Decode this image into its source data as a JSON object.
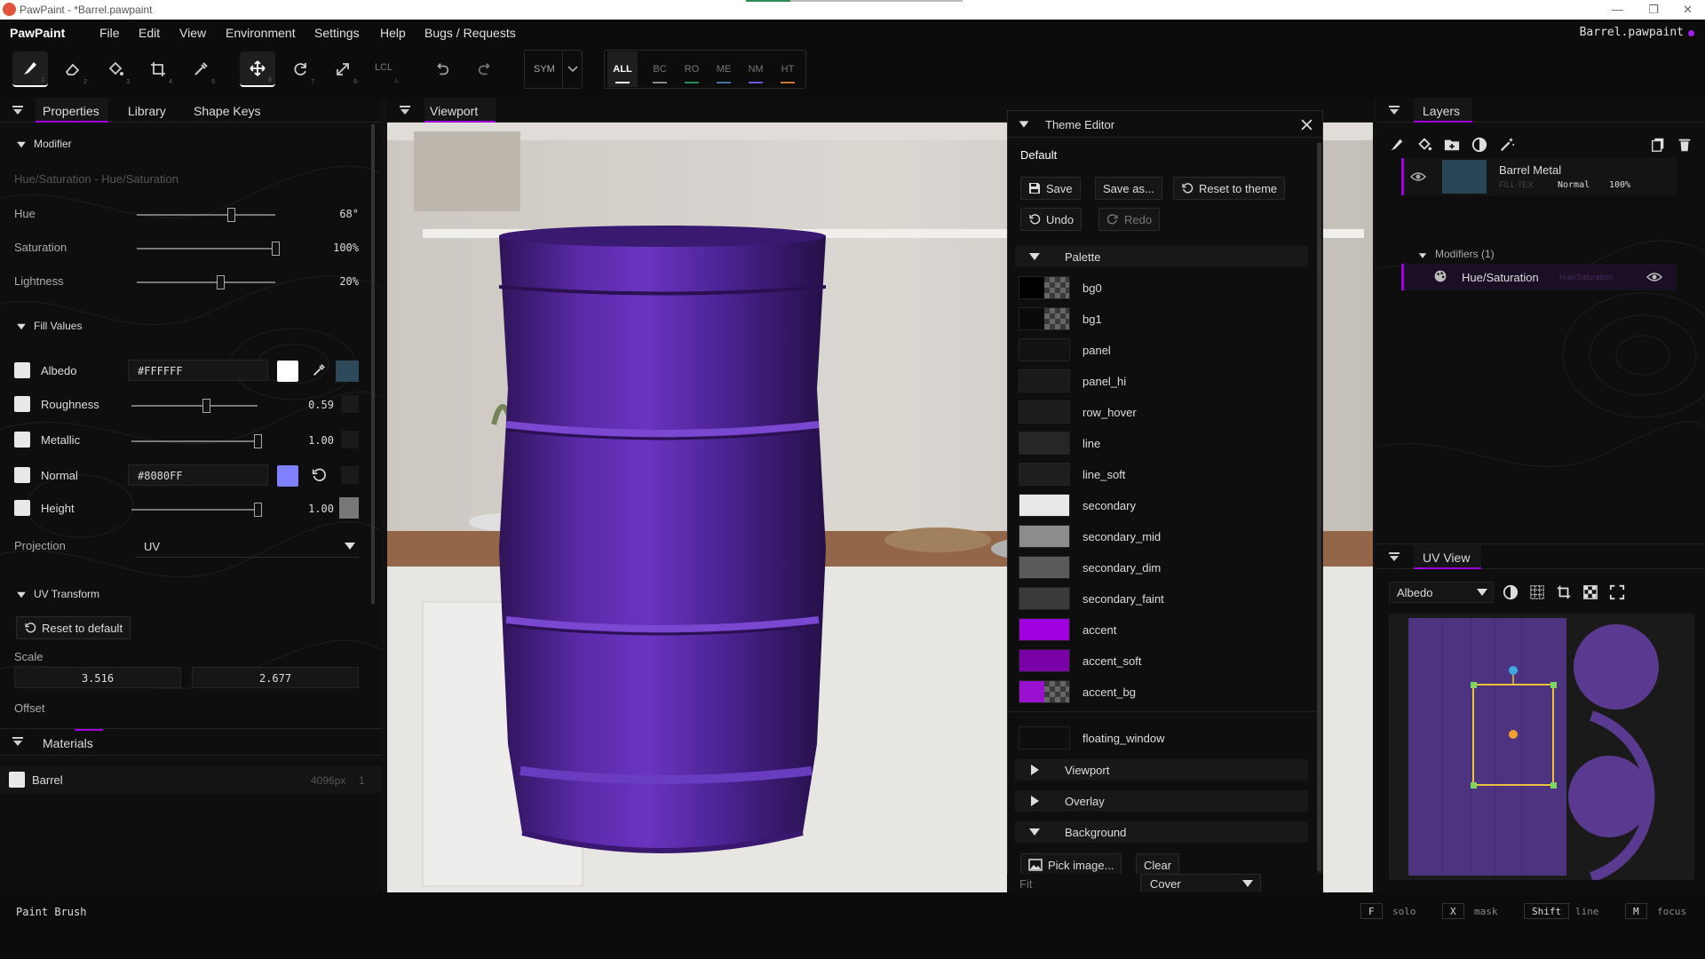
{
  "window": {
    "title": "PawPaint - *Barrel.pawpaint"
  },
  "menubar": {
    "brand": "PawPaint",
    "items": [
      "File",
      "Edit",
      "View",
      "Environment",
      "Settings",
      "Help",
      "Bugs / Requests"
    ],
    "file": "Barrel.pawpaint"
  },
  "toolbar": {
    "tool_numbers": [
      "1",
      "2",
      "3",
      "4",
      "5",
      "6",
      "7",
      "8"
    ],
    "lcl": "LCL",
    "lcl_key": "L",
    "sym": "SYM",
    "channels": [
      "ALL",
      "BC",
      "RO",
      "ME",
      "NM",
      "HT"
    ],
    "channel_colors": [
      "#ffffff",
      "#888888",
      "#2e8b57",
      "#4a6fa5",
      "#6a5acd",
      "#c87533"
    ]
  },
  "left": {
    "tabs": [
      "Properties",
      "Library",
      "Shape Keys"
    ],
    "modifier": {
      "header": "Modifier",
      "subtitle": "Hue/Saturation - Hue/Saturation",
      "rows": [
        {
          "label": "Hue",
          "value": "68°",
          "frac": 0.68
        },
        {
          "label": "Saturation",
          "value": "100%",
          "frac": 1.0
        },
        {
          "label": "Lightness",
          "value": "20%",
          "frac": 0.6
        }
      ]
    },
    "fill": {
      "header": "Fill Values",
      "albedo": {
        "label": "Albedo",
        "value": "#FFFFFF"
      },
      "roughness": {
        "label": "Roughness",
        "value": "0.59",
        "frac": 0.59
      },
      "metallic": {
        "label": "Metallic",
        "value": "1.00",
        "frac": 1.0
      },
      "normal": {
        "label": "Normal",
        "value": "#8080FF"
      },
      "height": {
        "label": "Height",
        "value": "1.00",
        "frac": 1.0
      },
      "projection": {
        "label": "Projection",
        "value": "UV"
      }
    },
    "uv": {
      "header": "UV Transform",
      "reset": "Reset to default",
      "scale_label": "Scale",
      "scale": [
        "3.516",
        "2.677"
      ],
      "offset_label": "Offset"
    },
    "materials": {
      "header": "Materials",
      "items": [
        {
          "name": "Barrel",
          "size": "4096px",
          "count": "1"
        }
      ]
    }
  },
  "viewport": {
    "title": "Viewport"
  },
  "theme": {
    "title": "Theme Editor",
    "name": "Default",
    "save": "Save",
    "save_as": "Save as...",
    "reset": "Reset to theme",
    "undo": "Undo",
    "redo": "Redo",
    "palette_header": "Palette",
    "palette": [
      {
        "name": "bg0",
        "color": "#000000",
        "checker": true
      },
      {
        "name": "bg1",
        "color": "#0a0a0a",
        "checker": true
      },
      {
        "name": "panel",
        "color": "#121212"
      },
      {
        "name": "panel_hi",
        "color": "#1a1a1a"
      },
      {
        "name": "row_hover",
        "color": "#1c1c1c"
      },
      {
        "name": "line",
        "color": "#262626"
      },
      {
        "name": "line_soft",
        "color": "#1e1e1e"
      },
      {
        "name": "secondary",
        "color": "#e8e8e8"
      },
      {
        "name": "secondary_mid",
        "color": "#8c8c8c"
      },
      {
        "name": "secondary_dim",
        "color": "#5a5a5a"
      },
      {
        "name": "secondary_faint",
        "color": "#3a3a3a"
      },
      {
        "name": "accent",
        "color": "#a000e0"
      },
      {
        "name": "accent_soft",
        "color": "#7a00a8"
      },
      {
        "name": "accent_bg",
        "color": "#9a10d0",
        "checker": true
      }
    ],
    "floating": {
      "name": "floating_window",
      "color": "#0e0e0e"
    },
    "sections": [
      "Viewport",
      "Overlay",
      "Background"
    ],
    "pick": "Pick image...",
    "clear": "Clear",
    "fit_label": "Fit",
    "fit_value": "Cover"
  },
  "layers": {
    "title": "Layers",
    "layer": {
      "name": "Barrel Metal",
      "type": "FILL·TEX",
      "blend": "Normal",
      "opacity": "100%"
    },
    "modifiers_label": "Modifiers (1)",
    "modifier": {
      "name": "Hue/Saturation",
      "sub": "Hue/Saturation"
    }
  },
  "uvview": {
    "title": "UV View",
    "channel": "Albedo"
  },
  "status": {
    "tool": "Paint Brush",
    "hints": [
      {
        "key": "F",
        "text": "solo"
      },
      {
        "key": "X",
        "text": "mask"
      },
      {
        "key": "Shift",
        "text": "line"
      },
      {
        "key": "M",
        "text": "focus"
      }
    ]
  }
}
